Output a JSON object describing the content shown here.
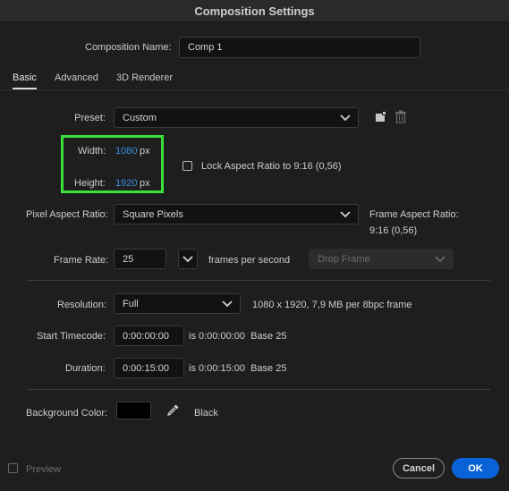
{
  "window": {
    "title": "Composition Settings"
  },
  "composition_name": {
    "label": "Composition Name:",
    "value": "Comp 1"
  },
  "tabs": [
    {
      "label": "Basic",
      "active": true
    },
    {
      "label": "Advanced",
      "active": false
    },
    {
      "label": "3D Renderer",
      "active": false
    }
  ],
  "preset": {
    "label": "Preset:",
    "value": "Custom",
    "save_icon": "save-preset-icon",
    "delete_icon": "trash-icon"
  },
  "width": {
    "label": "Width:",
    "value": "1080",
    "unit": "px"
  },
  "height": {
    "label": "Height:",
    "value": "1920",
    "unit": "px"
  },
  "lock_aspect": {
    "label": "Lock Aspect Ratio to 9:16 (0,56)",
    "checked": false
  },
  "highlight_color": "#3be03b",
  "pixel_aspect": {
    "label": "Pixel Aspect Ratio:",
    "value": "Square Pixels"
  },
  "frame_aspect": {
    "label": "Frame Aspect Ratio:",
    "value": "9:16 (0,56)"
  },
  "frame_rate": {
    "label": "Frame Rate:",
    "value": "25",
    "unit": "frames per second",
    "drop_frame": "Drop Frame"
  },
  "resolution": {
    "label": "Resolution:",
    "value": "Full",
    "info": "1080 x 1920, 7,9 MB per 8bpc frame"
  },
  "start_timecode": {
    "label": "Start Timecode:",
    "value": "0:00:00:00",
    "info": "is 0:00:00:00  Base 25"
  },
  "duration": {
    "label": "Duration:",
    "value": "0:00:15:00",
    "info": "is 0:00:15:00  Base 25"
  },
  "background": {
    "label": "Background Color:",
    "swatch": "#000000",
    "name": "Black"
  },
  "footer": {
    "preview_label": "Preview",
    "cancel_label": "Cancel",
    "ok_label": "OK"
  },
  "colors": {
    "accent": "#0a62d8",
    "link": "#3d8ee8"
  }
}
